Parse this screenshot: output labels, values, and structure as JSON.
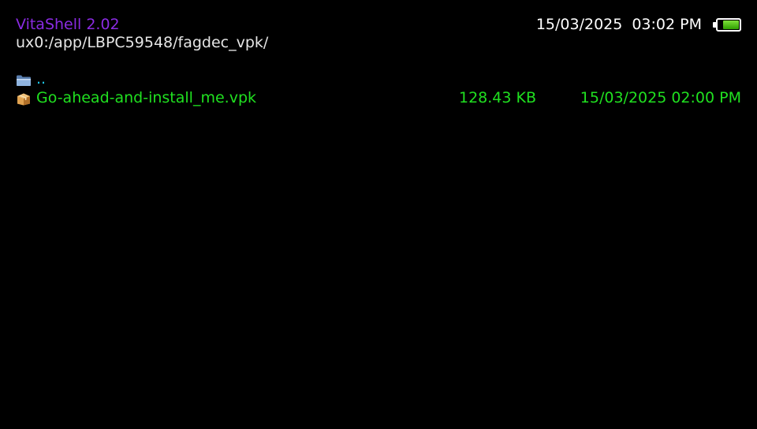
{
  "header": {
    "app_title": "VitaShell 2.02",
    "current_path": "ux0:/app/LBPC59548/fagdec_vpk/"
  },
  "status": {
    "date": "15/03/2025",
    "time": "03:02 PM",
    "battery_level": 0.7,
    "battery_icon": "battery-icon"
  },
  "files": [
    {
      "icon": "folder-icon",
      "name": "..",
      "size": "",
      "modified": ""
    },
    {
      "icon": "package-icon",
      "name": "Go-ahead-and-install_me.vpk",
      "size": "128.43 KB",
      "modified": "15/03/2025 02:00 PM"
    }
  ],
  "colors": {
    "title": "#8a2be2",
    "path": "#e6e6e6",
    "folder_text": "#1ec8e8",
    "file_text": "#20e020",
    "background": "#000000"
  }
}
